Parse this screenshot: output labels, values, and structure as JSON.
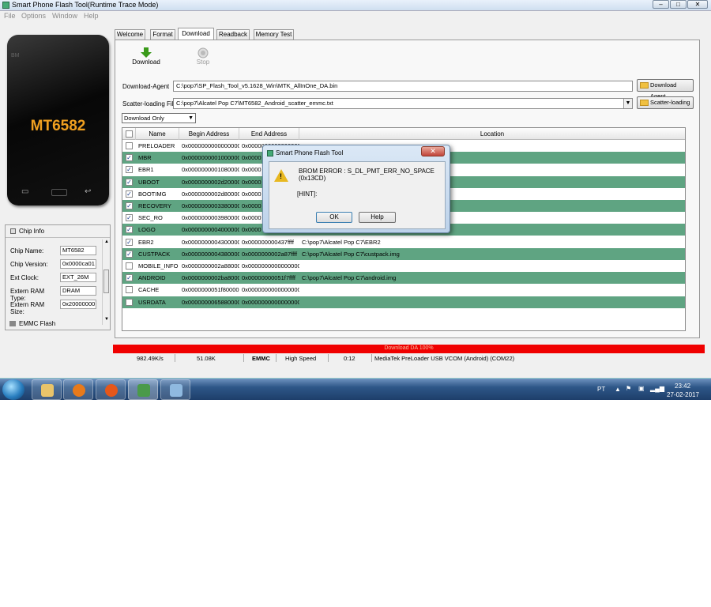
{
  "window": {
    "title": "Smart Phone Flash Tool(Runtime Trace Mode)",
    "minimize": "–",
    "maximize": "□",
    "close": "✕"
  },
  "menu": [
    "File",
    "Options",
    "Window",
    "Help"
  ],
  "phone": {
    "brand_text": "BM",
    "chip_label": "MT6582"
  },
  "chip_info": {
    "header": "Chip Info",
    "rows": [
      {
        "label": "Chip Name:",
        "value": "MT6582"
      },
      {
        "label": "Chip Version:",
        "value": "0x0000ca01"
      },
      {
        "label": "Ext Clock:",
        "value": "EXT_26M"
      },
      {
        "label": "Extern RAM Type:",
        "value": "DRAM"
      },
      {
        "label": "Extern RAM Size:",
        "value": "0x20000000"
      }
    ],
    "emmc_label": "EMMC Flash"
  },
  "tabs": [
    {
      "label": "Welcome",
      "active": false
    },
    {
      "label": "Format",
      "active": false
    },
    {
      "label": "Download",
      "active": true
    },
    {
      "label": "Readback",
      "active": false
    },
    {
      "label": "Memory Test",
      "active": false
    }
  ],
  "toolbar": {
    "download_label": "Download",
    "stop_label": "Stop"
  },
  "download_agent": {
    "label": "Download-Agent",
    "value": "C:\\pop7\\SP_Flash_Tool_v5.1628_Win\\MTK_AllInOne_DA.bin",
    "button": "Download Agent"
  },
  "scatter": {
    "label": "Scatter-loading File",
    "value": "C:\\pop7\\Alcatel Pop C7\\MT6582_Android_scatter_emmc.txt",
    "button": "Scatter-loading"
  },
  "mode": {
    "selected": "Download Only"
  },
  "table": {
    "headers": [
      "",
      "Name",
      "Begin Address",
      "End Address",
      "Location"
    ],
    "rows": [
      {
        "checked": false,
        "name": "PRELOADER",
        "begin": "0x0000000000000000",
        "end": "0x0000000000000000",
        "location": ""
      },
      {
        "checked": true,
        "name": "MBR",
        "begin": "0x0000000001000000",
        "end": "0x0000",
        "location": ""
      },
      {
        "checked": true,
        "name": "EBR1",
        "begin": "0x0000000001080000",
        "end": "0x0000",
        "location": ""
      },
      {
        "checked": true,
        "name": "UBOOT",
        "begin": "0x0000000002d20000",
        "end": "0x0000",
        "location": ""
      },
      {
        "checked": true,
        "name": "BOOTIMG",
        "begin": "0x0000000002d80000",
        "end": "0x0000",
        "location": ""
      },
      {
        "checked": true,
        "name": "RECOVERY",
        "begin": "0x0000000003380000",
        "end": "0x0000",
        "location": ""
      },
      {
        "checked": true,
        "name": "SEC_RO",
        "begin": "0x0000000003980000",
        "end": "0x0000",
        "location": ""
      },
      {
        "checked": true,
        "name": "LOGO",
        "begin": "0x0000000004000000",
        "end": "0x0000",
        "location": ""
      },
      {
        "checked": true,
        "name": "EBR2",
        "begin": "0x0000000004300000",
        "end": "0x000000000437ffff",
        "location": "C:\\pop7\\Alcatel Pop C7\\EBR2"
      },
      {
        "checked": true,
        "name": "CUSTPACK",
        "begin": "0x0000000004380000",
        "end": "0x0000000002a87ffff",
        "location": "C:\\pop7\\Alcatel Pop C7\\custpack.img"
      },
      {
        "checked": false,
        "name": "MOBILE_INFO",
        "begin": "0x0000000002a880000",
        "end": "0x0000000000000000",
        "location": ""
      },
      {
        "checked": true,
        "name": "ANDROID",
        "begin": "0x0000000002ba80000",
        "end": "0x00000000051f7ffff",
        "location": "C:\\pop7\\Alcatel Pop C7\\android.img"
      },
      {
        "checked": false,
        "name": "CACHE",
        "begin": "0x0000000051f80000",
        "end": "0x0000000000000000",
        "location": ""
      },
      {
        "checked": false,
        "name": "USRDATA",
        "begin": "0x0000000065880000",
        "end": "0x0000000000000000",
        "location": ""
      }
    ]
  },
  "progress": {
    "text": "Download DA 100%",
    "percent": 100
  },
  "status_bar": {
    "speed": "982.49K/s",
    "size": "51.08K",
    "storage": "EMMC",
    "usb_speed": "High Speed",
    "time": "0:12",
    "port": "MediaTek PreLoader USB VCOM (Android) (COM22)"
  },
  "dialog": {
    "title": "Smart Phone Flash Tool",
    "close": "✕",
    "message": "BROM ERROR : S_DL_PMT_ERR_NO_SPACE (0x13CD)",
    "hint": "[HINT]:",
    "ok": "OK",
    "help": "Help"
  },
  "taskbar": {
    "lang": "PT",
    "time": "23:42",
    "date": "27-02-2017"
  },
  "colors": {
    "row_highlight": "#5fa482",
    "progress": "#f00000",
    "taskbar": "#2e5788"
  }
}
